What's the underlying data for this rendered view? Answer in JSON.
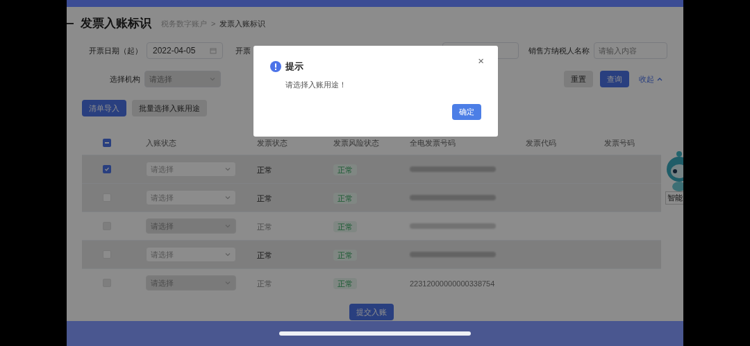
{
  "header": {
    "title": "发票入账标识",
    "breadcrumb": [
      "税务数字账户",
      "发票入账标识"
    ],
    "breadcrumb_separator": ">"
  },
  "filters": [
    {
      "label": "开票日期（起）",
      "value": "2022-04-05",
      "kind": "date"
    },
    {
      "label": "开票",
      "kind": "blank"
    },
    {
      "label": "销售方纳税人名称",
      "placeholder": "请输入内容",
      "kind": "text"
    }
  ],
  "org_filter": {
    "label": "选择机构",
    "placeholder": "请选择",
    "disabled": true
  },
  "filter_buttons": [
    {
      "label": "重置",
      "kind": "plain"
    },
    {
      "label": "查询",
      "kind": "primary"
    },
    {
      "label": "收起",
      "kind": "link"
    }
  ],
  "actions": [
    {
      "label": "清单导入",
      "kind": "primary"
    },
    {
      "label": "批量选择入账用途",
      "kind": "plain"
    }
  ],
  "table": {
    "header_checkbox": {
      "indeterminate": true
    },
    "columns": [
      "入账状态",
      "发票状态",
      "发票风险状态",
      "全电发票号码",
      "发票代码",
      "发票号码"
    ],
    "rows": [
      {
        "checked": true,
        "disabled": false,
        "entry_status": "请选择",
        "invoice_status": "正常",
        "risk_status": "正常",
        "number_redacted": true
      },
      {
        "checked": false,
        "disabled": false,
        "entry_status": "请选择",
        "invoice_status": "正常",
        "risk_status": "正常",
        "number_redacted": true
      },
      {
        "checked": false,
        "disabled": true,
        "entry_status": "请选择",
        "invoice_status": "正常",
        "risk_status": "正常",
        "number_redacted": true
      },
      {
        "checked": false,
        "disabled": false,
        "entry_status": "请选择",
        "invoice_status": "正常",
        "risk_status": "正常",
        "number_redacted": true
      },
      {
        "checked": false,
        "disabled": true,
        "entry_status": "请选择",
        "invoice_status": "正常",
        "risk_status": "正常",
        "number_redacted": false,
        "invoice_number": "22312000000000338754"
      }
    ]
  },
  "submit_button": "提交入账",
  "assistant": {
    "label": "智能"
  },
  "dialog": {
    "title": "提示",
    "message": "请选择入账用途！",
    "close": "×",
    "confirm": "确定"
  }
}
